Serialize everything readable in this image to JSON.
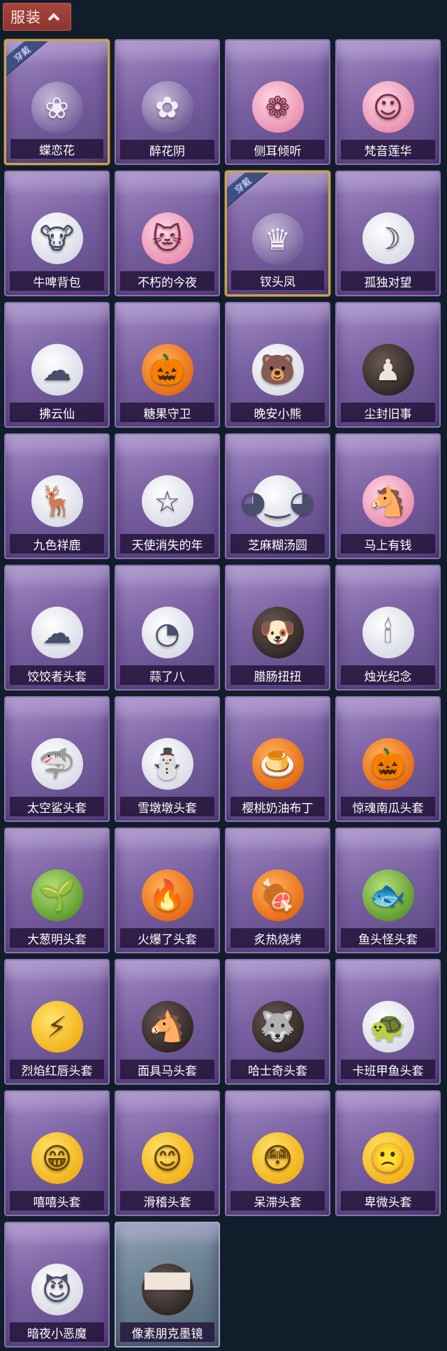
{
  "header": {
    "title": "服装"
  },
  "badge_text": "穿戴",
  "items": [
    {
      "name": "蝶恋花",
      "equipped": true,
      "icon": "butterfly-hoop",
      "glyph": "❀",
      "tone": ""
    },
    {
      "name": "醉花阴",
      "equipped": false,
      "icon": "flower-wreath",
      "glyph": "✿",
      "tone": ""
    },
    {
      "name": "侧耳倾听",
      "equipped": false,
      "icon": "lotus-hoop",
      "glyph": "❁",
      "tone": "pink"
    },
    {
      "name": "梵音莲华",
      "equipped": false,
      "icon": "chibi-figure",
      "glyph": "☺",
      "tone": "pink"
    },
    {
      "name": "牛啤背包",
      "equipped": false,
      "icon": "cow-barrel",
      "glyph": "🐮",
      "tone": "white"
    },
    {
      "name": "不朽的今夜",
      "equipped": false,
      "icon": "pink-cat-bowl",
      "glyph": "🐱",
      "tone": "pink"
    },
    {
      "name": "钗头凤",
      "equipped": true,
      "icon": "phoenix-crown-doll",
      "glyph": "♛",
      "tone": ""
    },
    {
      "name": "孤独对望",
      "equipped": false,
      "icon": "white-hair-doll",
      "glyph": "☽",
      "tone": "white"
    },
    {
      "name": "拂云仙",
      "equipped": false,
      "icon": "cloud-fairy-charm",
      "glyph": "☁",
      "tone": "white"
    },
    {
      "name": "糖果守卫",
      "equipped": false,
      "icon": "pumpkin-scarecrow-charm",
      "glyph": "🎃",
      "tone": "orange"
    },
    {
      "name": "晚安小熊",
      "equipped": false,
      "icon": "bear-charm",
      "glyph": "🐻",
      "tone": "white"
    },
    {
      "name": "尘封旧事",
      "equipped": false,
      "icon": "dark-doll-charm",
      "glyph": "♟",
      "tone": "dark"
    },
    {
      "name": "九色祥鹿",
      "equipped": false,
      "icon": "deer-charm",
      "glyph": "🦌",
      "tone": "white"
    },
    {
      "name": "天使消失的年",
      "equipped": false,
      "icon": "angel-doll-charm",
      "glyph": "☆",
      "tone": "white"
    },
    {
      "name": "芝麻糊汤圆",
      "equipped": false,
      "icon": "dumpling-mascot",
      "glyph": "◕‿◕",
      "tone": "white"
    },
    {
      "name": "马上有钱",
      "equipped": false,
      "icon": "horse-mascot",
      "glyph": "🐴",
      "tone": "pink"
    },
    {
      "name": "饺饺者头套",
      "equipped": false,
      "icon": "cloud-head",
      "glyph": "☁",
      "tone": "white"
    },
    {
      "name": "蒜了八",
      "equipped": false,
      "icon": "garlic-head",
      "glyph": "◔",
      "tone": "white"
    },
    {
      "name": "腊肠扭扭",
      "equipped": false,
      "icon": "dog-head",
      "glyph": "🐶",
      "tone": "dark"
    },
    {
      "name": "烛光纪念",
      "equipped": false,
      "icon": "candle-head",
      "glyph": "🕯",
      "tone": "white"
    },
    {
      "name": "太空鲨头套",
      "equipped": false,
      "icon": "shark-head",
      "glyph": "🦈",
      "tone": "white"
    },
    {
      "name": "雪墩墩头套",
      "equipped": false,
      "icon": "snowman-head",
      "glyph": "⛄",
      "tone": "white"
    },
    {
      "name": "樱桃奶油布丁",
      "equipped": false,
      "icon": "pudding-head",
      "glyph": "🍮",
      "tone": "orange"
    },
    {
      "name": "惊魂南瓜头套",
      "equipped": false,
      "icon": "pumpkin-head",
      "glyph": "🎃",
      "tone": "orange"
    },
    {
      "name": "大葱明头套",
      "equipped": false,
      "icon": "scallion-head",
      "glyph": "🌱",
      "tone": "green"
    },
    {
      "name": "火爆了头套",
      "equipped": false,
      "icon": "fire-head",
      "glyph": "🔥",
      "tone": "orange"
    },
    {
      "name": "炙热烧烤",
      "equipped": false,
      "icon": "bbq-meat-head",
      "glyph": "🍖",
      "tone": "orange"
    },
    {
      "name": "鱼头怪头套",
      "equipped": false,
      "icon": "fish-head",
      "glyph": "🐟",
      "tone": "green"
    },
    {
      "name": "烈焰红唇头套",
      "equipped": false,
      "icon": "pikachu-head",
      "glyph": "⚡",
      "tone": "emoji"
    },
    {
      "name": "面具马头套",
      "equipped": false,
      "icon": "horse-mask-head",
      "glyph": "🐴",
      "tone": "dark"
    },
    {
      "name": "哈士奇头套",
      "equipped": false,
      "icon": "husky-head",
      "glyph": "🐺",
      "tone": "dark"
    },
    {
      "name": "卡班甲鱼头套",
      "equipped": false,
      "icon": "turtle-head",
      "glyph": "🐢",
      "tone": "white"
    },
    {
      "name": "嘻嘻头套",
      "equipped": false,
      "icon": "grin-emoji-head",
      "glyph": "😁",
      "tone": "emoji"
    },
    {
      "name": "滑稽头套",
      "equipped": false,
      "icon": "smirk-emoji-head",
      "glyph": "😊",
      "tone": "emoji"
    },
    {
      "name": "呆滞头套",
      "equipped": false,
      "icon": "stare-emoji-head",
      "glyph": "😳",
      "tone": "emoji"
    },
    {
      "name": "卑微头套",
      "equipped": false,
      "icon": "timid-emoji-head",
      "glyph": "🙁",
      "tone": "emoji"
    },
    {
      "name": "暗夜小恶魔",
      "equipped": false,
      "icon": "devil-head",
      "glyph": "😈",
      "tone": "white"
    },
    {
      "name": "像素朋克墨镜",
      "equipped": false,
      "icon": "pixel-sunglasses",
      "glyph": "▀▀",
      "tone": "dark",
      "special": true
    }
  ]
}
